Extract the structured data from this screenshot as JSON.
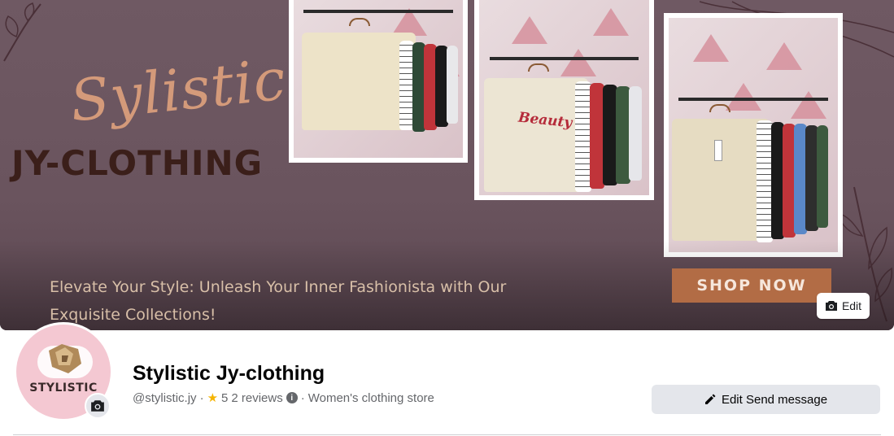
{
  "cover": {
    "script_title": "Sylistic",
    "brand_title": "JY-CLOTHING",
    "shirt_print": "Beauty",
    "tagline": "Elevate Your Style: Unleash Your Inner Fashionista with Our Exquisite Collections!",
    "shop_now": "SHOP NOW",
    "edit_label": "Edit"
  },
  "profile": {
    "avatar_text": "STYLISTIC",
    "name": "Stylistic Jy-clothing",
    "handle": "@stylistic.jy",
    "separator": "·",
    "rating": "5",
    "reviews": "2 reviews",
    "category": "Women's clothing store"
  },
  "actions": {
    "send_message": "Edit Send message"
  },
  "icons": {
    "camera": "camera-icon",
    "pencil": "pencil-icon",
    "star": "star-icon",
    "info": "info-icon"
  },
  "colors": {
    "cover_bg": "#6b5560",
    "accent_peach": "#d49a7a",
    "shop_button": "#b26c45",
    "avatar_bg": "#f4c8d2",
    "button_bg": "#e4e6eb"
  }
}
